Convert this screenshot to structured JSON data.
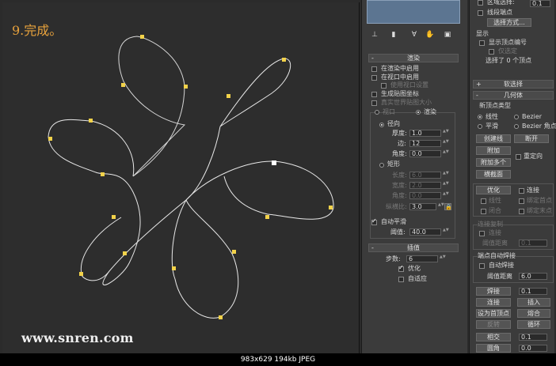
{
  "viewport": {
    "step_label": "9.完成。",
    "watermark": "www.snren.com"
  },
  "render_panel": {
    "rollout_title": "渲染",
    "enable_in_renderer": "在渲染中启用",
    "enable_in_viewport": "在视口中启用",
    "use_viewport_settings": "使用视口设置",
    "generate_mapping": "生成贴图坐标",
    "real_world_map_size": "真实世界贴图大小",
    "viewport_option": "视口",
    "renderer_option": "渲染",
    "radial_option": "径向",
    "thickness_label": "厚度:",
    "thickness_value": "1.0",
    "sides_label": "边:",
    "sides_value": "12",
    "angle_label": "角度:",
    "angle_value": "0.0",
    "rectangular_option": "矩形",
    "length_label": "长度:",
    "length_value": "6.0",
    "width_label": "宽度:",
    "width_value": "2.0",
    "rect_angle_label": "角度:",
    "rect_angle_value": "0.0",
    "aspect_label": "纵横比:",
    "aspect_value": "3.0",
    "auto_smooth": "自动平滑",
    "threshold_label": "阈值:",
    "threshold_value": "40.0"
  },
  "interp_panel": {
    "rollout_title": "插值",
    "steps_label": "步数:",
    "steps_value": "6",
    "optimize": "优化",
    "adaptive": "自适应"
  },
  "top_panel": {
    "soft_select_label": "区域选择:",
    "soft_select_value": "0.1",
    "segment_end": "线段端点",
    "select_method": "选择方式...",
    "display_group": "显示",
    "show_vertex_numbers": "显示顶点编号",
    "selected_only": "仅选定",
    "selection_info": "选择了 0 个顶点"
  },
  "geometry_panel": {
    "soft_selection_title": "软选择",
    "geometry_title": "几何体",
    "new_vertex_type": "新顶点类型",
    "linear": "线性",
    "bezier": "Bezier",
    "smooth": "平滑",
    "bezier_corner": "Bezier 角点",
    "create_line": "创建线",
    "break": "断开",
    "attach": "附加",
    "reorient": "重定向",
    "attach_multiple": "附加多个",
    "cross_section": "横截面",
    "refine": "优化",
    "connect": "连接",
    "linear2": "线性",
    "bind_first": "绑定首点",
    "closed": "闭合",
    "bind_last": "绑定末点",
    "connect_copy_group": "连接复制",
    "connect_copy_connect": "连接",
    "connect_copy_threshold_label": "阈值距离",
    "connect_copy_threshold_value": "0.1",
    "end_auto_weld": "端点自动焊接",
    "auto_weld": "自动焊接",
    "weld_threshold_label": "阈值距离",
    "weld_threshold_value": "6.0",
    "weld": "焊接",
    "weld_value": "0.1",
    "connect_btn": "连接",
    "insert": "插入",
    "make_first": "设为首顶点",
    "fuse": "熔合",
    "reverse": "反转",
    "cycle": "循环",
    "cross_insert": "相交",
    "cross_insert_value": "0.1",
    "fillet": "圆角",
    "fillet_value": "0.0"
  },
  "status_bar": {
    "text": "983x629  194kb  JPEG"
  }
}
